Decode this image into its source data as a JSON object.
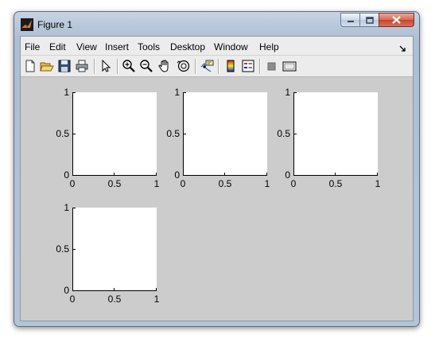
{
  "window": {
    "title": "Figure 1",
    "controls": [
      "minimize",
      "maximize",
      "close"
    ]
  },
  "menubar": {
    "items": [
      "File",
      "Edit",
      "View",
      "Insert",
      "Tools",
      "Desktop",
      "Window",
      "Help"
    ]
  },
  "toolbar": {
    "buttons": [
      {
        "name": "new-figure-icon"
      },
      {
        "name": "open-file-icon"
      },
      {
        "name": "save-icon"
      },
      {
        "name": "print-icon"
      },
      {
        "name": "edit-plot-icon"
      },
      {
        "name": "zoom-in-icon"
      },
      {
        "name": "zoom-out-icon"
      },
      {
        "name": "pan-icon"
      },
      {
        "name": "rotate-3d-icon"
      },
      {
        "name": "data-cursor-icon"
      },
      {
        "name": "insert-colorbar-icon"
      },
      {
        "name": "insert-legend-icon"
      },
      {
        "name": "hide-plot-tools-icon"
      },
      {
        "name": "show-plot-tools-icon"
      }
    ]
  },
  "chart_data": [
    {
      "type": "line",
      "series": [],
      "xlim": [
        0,
        1
      ],
      "ylim": [
        0,
        1
      ],
      "xticks": [
        "0",
        "0.5",
        "1"
      ],
      "yticks": [
        "0",
        "0.5",
        "1"
      ],
      "grid": false
    },
    {
      "type": "line",
      "series": [],
      "xlim": [
        0,
        1
      ],
      "ylim": [
        0,
        1
      ],
      "xticks": [
        "0",
        "0.5",
        "1"
      ],
      "yticks": [
        "0",
        "0.5",
        "1"
      ],
      "grid": false
    },
    {
      "type": "line",
      "series": [],
      "xlim": [
        0,
        1
      ],
      "ylim": [
        0,
        1
      ],
      "xticks": [
        "0",
        "0.5",
        "1"
      ],
      "yticks": [
        "0",
        "0.5",
        "1"
      ],
      "grid": false
    },
    {
      "type": "line",
      "series": [],
      "xlim": [
        0,
        1
      ],
      "ylim": [
        0,
        1
      ],
      "xticks": [
        "0",
        "0.5",
        "1"
      ],
      "yticks": [
        "0",
        "0.5",
        "1"
      ],
      "grid": false
    }
  ]
}
